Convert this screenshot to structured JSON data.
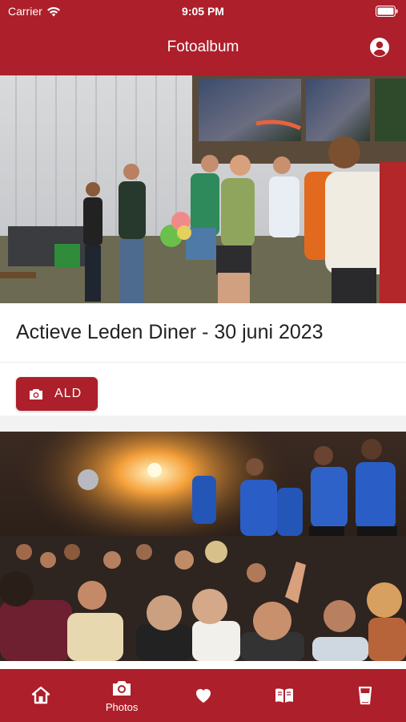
{
  "status_bar": {
    "carrier": "Carrier",
    "time": "9:05 PM"
  },
  "nav": {
    "title": "Fotoalbum",
    "profile_icon": "user-circle-icon"
  },
  "albums": [
    {
      "title": "Actieve Leden Diner - 30 juni 2023",
      "button_label": "ALD",
      "button_icon": "camera-icon",
      "photo_description": "outdoor party group dancing"
    },
    {
      "photo_description": "indoor party crowd with lights"
    }
  ],
  "tabs": [
    {
      "icon": "home-icon",
      "label": ""
    },
    {
      "icon": "camera-icon",
      "label": "Photos"
    },
    {
      "icon": "heart-icon",
      "label": ""
    },
    {
      "icon": "book-icon",
      "label": ""
    },
    {
      "icon": "glass-icon",
      "label": ""
    }
  ],
  "colors": {
    "brand": "#ad1f2a",
    "background": "#f2f2f2"
  }
}
